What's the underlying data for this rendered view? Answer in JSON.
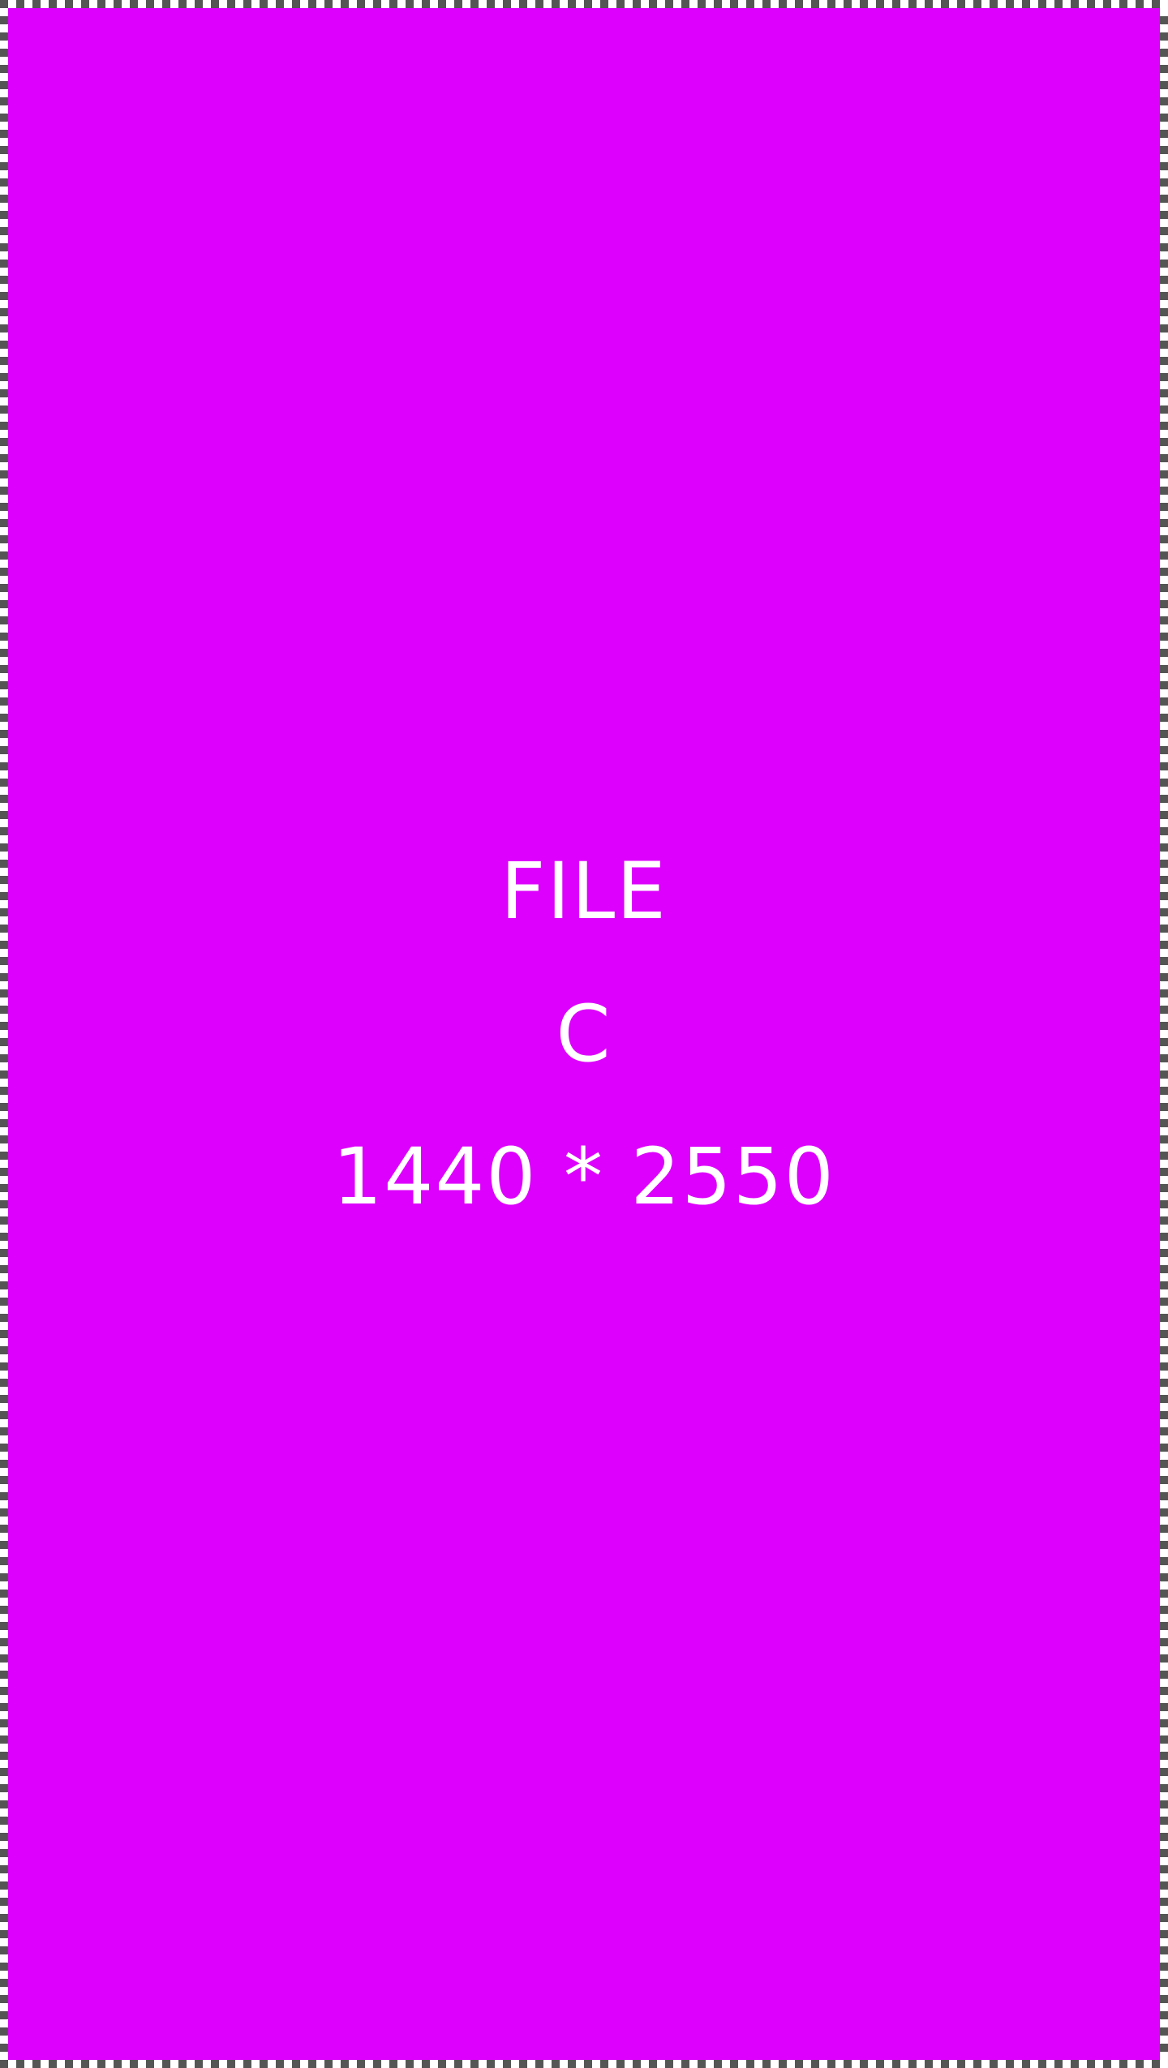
{
  "placeholder": {
    "line1": "FILE",
    "line2": "C",
    "line3": "1440 * 2550"
  },
  "colors": {
    "background": "#dc00fc",
    "text": "#ffffff",
    "border_dash": "#555555"
  }
}
